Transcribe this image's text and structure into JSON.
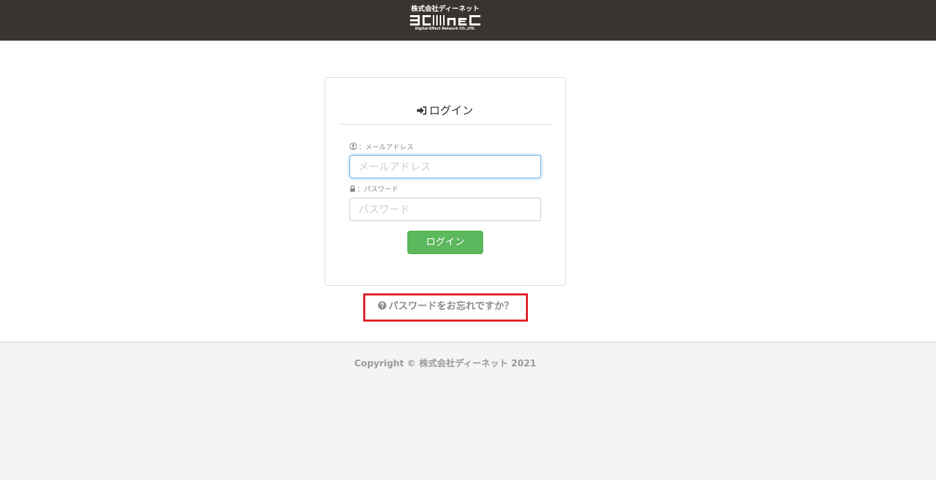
{
  "header": {
    "logo_top": "株式会社ディーネット",
    "logo_mark": "Dellnet",
    "logo_sub": "Digital-Effect Network CO.,LTD."
  },
  "login_card": {
    "title": "ログイン",
    "email_label": "：メールアドレス",
    "email_placeholder": "メールアドレス",
    "email_value": "",
    "password_label": "：パスワード",
    "password_placeholder": "パスワード",
    "password_value": "",
    "submit_label": "ログイン"
  },
  "forgot": {
    "label": "パスワードをお忘れですか？"
  },
  "footer": {
    "copyright": "Copyright © 株式会社ディーネット 2021"
  },
  "colors": {
    "header_bg": "#3a3431",
    "button_green": "#5cb85c",
    "highlight_red": "#e0202a",
    "footer_bg": "#f4f4f4"
  },
  "icons": {
    "title": "sign-in-icon",
    "email": "user-circle-icon",
    "password": "lock-icon",
    "forgot": "question-circle-icon"
  }
}
